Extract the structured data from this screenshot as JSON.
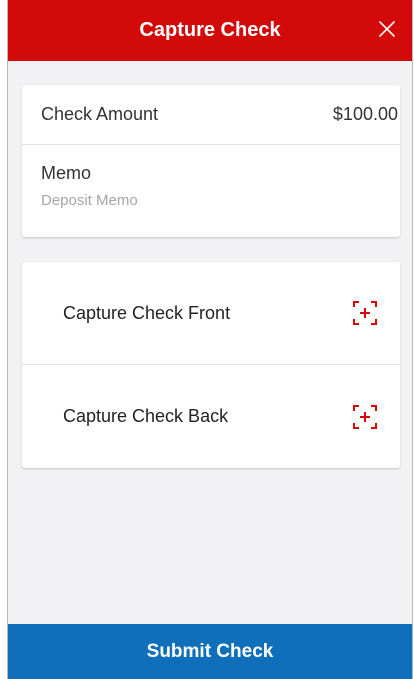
{
  "header": {
    "title": "Capture Check",
    "close_icon": "close-icon"
  },
  "details": {
    "amount_label": "Check Amount",
    "amount_value": "$100.00",
    "memo_label": "Memo",
    "memo_placeholder": "Deposit Memo",
    "memo_value": ""
  },
  "capture": {
    "front_label": "Capture Check Front",
    "back_label": "Capture Check Back",
    "icon": "camera-capture-icon"
  },
  "footer": {
    "submit_label": "Submit Check"
  },
  "colors": {
    "header_bg": "#d30a0a",
    "footer_bg": "#0f6fba",
    "capture_icon": "#d30a0a",
    "page_bg": "#f2f2f4"
  }
}
